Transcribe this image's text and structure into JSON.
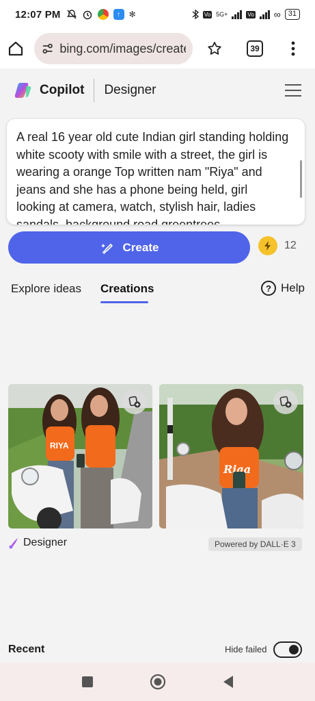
{
  "status_bar": {
    "time": "12:07 PM",
    "network_label": "5G+",
    "battery": "31"
  },
  "browser": {
    "url": "bing.com/images/create",
    "tab_count": "39"
  },
  "app": {
    "brand": "Copilot",
    "product": "Designer"
  },
  "prompt": {
    "text": "A real 16 year old cute Indian girl standing holding white scooty with smile with a street, the girl is wearing a orange Top written nam \"Riya\" and jeans and she has a phone being held, girl looking at camera, watch, stylish hair, ladies sandals, background road greentrees"
  },
  "create": {
    "button_label": "Create",
    "boosts": "12"
  },
  "tabs": {
    "explore": "Explore ideas",
    "creations": "Creations",
    "help": "Help"
  },
  "images": {
    "image1_shirt_text": "RIYA",
    "image2_shirt_text": "Riaa"
  },
  "attribution": {
    "designer_label": "Designer",
    "powered_by": "Powered by DALL·E 3"
  },
  "recent": {
    "title": "Recent",
    "hide_failed": "Hide failed"
  },
  "colors": {
    "accent": "#4f64e8",
    "shirt": "#f26a1b",
    "bolt": "#f5c22b"
  }
}
